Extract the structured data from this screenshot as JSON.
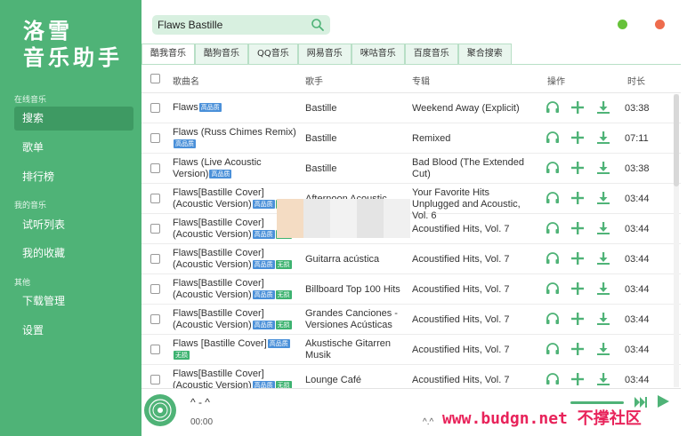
{
  "app": {
    "logo_line1": "洛雪",
    "logo_line2": "音乐助手"
  },
  "sidebar": {
    "sections": [
      {
        "title": "在线音乐",
        "items": [
          {
            "label": "搜索",
            "active": true
          },
          {
            "label": "歌单"
          },
          {
            "label": "排行榜"
          }
        ]
      },
      {
        "title": "我的音乐",
        "items": [
          {
            "label": "试听列表"
          },
          {
            "label": "我的收藏"
          }
        ]
      },
      {
        "title": "其他",
        "items": [
          {
            "label": "下载管理"
          },
          {
            "label": "设置"
          }
        ]
      }
    ]
  },
  "search": {
    "value": "Flaws Bastille",
    "icon": "search-icon"
  },
  "tabs": [
    {
      "label": "酷我音乐",
      "active": true
    },
    {
      "label": "酷狗音乐"
    },
    {
      "label": "QQ音乐"
    },
    {
      "label": "网易音乐"
    },
    {
      "label": "咪咕音乐"
    },
    {
      "label": "百度音乐"
    },
    {
      "label": "聚合搜索"
    }
  ],
  "table": {
    "headers": {
      "name": "歌曲名",
      "singer": "歌手",
      "album": "专辑",
      "actions": "操作",
      "duration": "时长"
    },
    "rows": [
      {
        "name": "Flaws",
        "tags": [
          "高品质"
        ],
        "singer": "Bastille",
        "album": "Weekend Away (Explicit)",
        "duration": "03:38"
      },
      {
        "name": "Flaws (Russ Chimes Remix)",
        "tags": [
          "高品质"
        ],
        "singer": "Bastille",
        "album": "Remixed",
        "duration": "07:11"
      },
      {
        "name": "Flaws (Live Acoustic Version)",
        "tags": [
          "高品质"
        ],
        "singer": "Bastille",
        "album": "Bad Blood (The Extended Cut)",
        "duration": "03:38"
      },
      {
        "name": "Flaws[Bastille Cover](Acoustic Version)",
        "tags": [
          "高品质",
          "无损"
        ],
        "singer": "Afternoon Acoustic",
        "album": "Your Favorite Hits Unplugged and Acoustic, Vol. 6",
        "duration": "03:44"
      },
      {
        "name": "Flaws[Bastille Cover](Acoustic Version)",
        "tags": [
          "高品质",
          "无损"
        ],
        "singer": "",
        "album": "Acoustified Hits, Vol. 7",
        "duration": "03:44"
      },
      {
        "name": "Flaws[Bastille Cover](Acoustic Version)",
        "tags": [
          "高品质",
          "无损"
        ],
        "singer": "Guitarra acústica",
        "album": "Acoustified Hits, Vol. 7",
        "duration": "03:44"
      },
      {
        "name": "Flaws[Bastille Cover](Acoustic Version)",
        "tags": [
          "高品质",
          "无损"
        ],
        "singer": "Billboard Top 100 Hits",
        "album": "Acoustified Hits, Vol. 7",
        "duration": "03:44"
      },
      {
        "name": "Flaws[Bastille Cover](Acoustic Version)",
        "tags": [
          "高品质",
          "无损"
        ],
        "singer": "Grandes Canciones - Versiones Acústicas",
        "album": "Acoustified Hits, Vol. 7",
        "duration": "03:44"
      },
      {
        "name": "Flaws [Bastille Cover]",
        "tags": [
          "高品质",
          "无损"
        ],
        "singer": "Akustische Gitarren Musik",
        "album": "Acoustified Hits, Vol. 7",
        "duration": "03:44"
      },
      {
        "name": "Flaws[Bastille Cover](Acoustic Version)",
        "tags": [
          "高品质",
          "无损"
        ],
        "singer": "Lounge Café",
        "album": "Acoustified Hits, Vol. 7",
        "duration": "03:44"
      }
    ]
  },
  "player": {
    "title": "^ - ^",
    "current_time": "00:00",
    "end_time": "^.^"
  },
  "watermark": "www.budgn.net 不撑社区",
  "colors": {
    "brand": "#4fb377",
    "accent_dark": "#3e9a63",
    "hq_tag": "#4a90d9",
    "free_tag": "#3eb371",
    "minimize": "#67c23a",
    "close": "#ee6c4d"
  }
}
